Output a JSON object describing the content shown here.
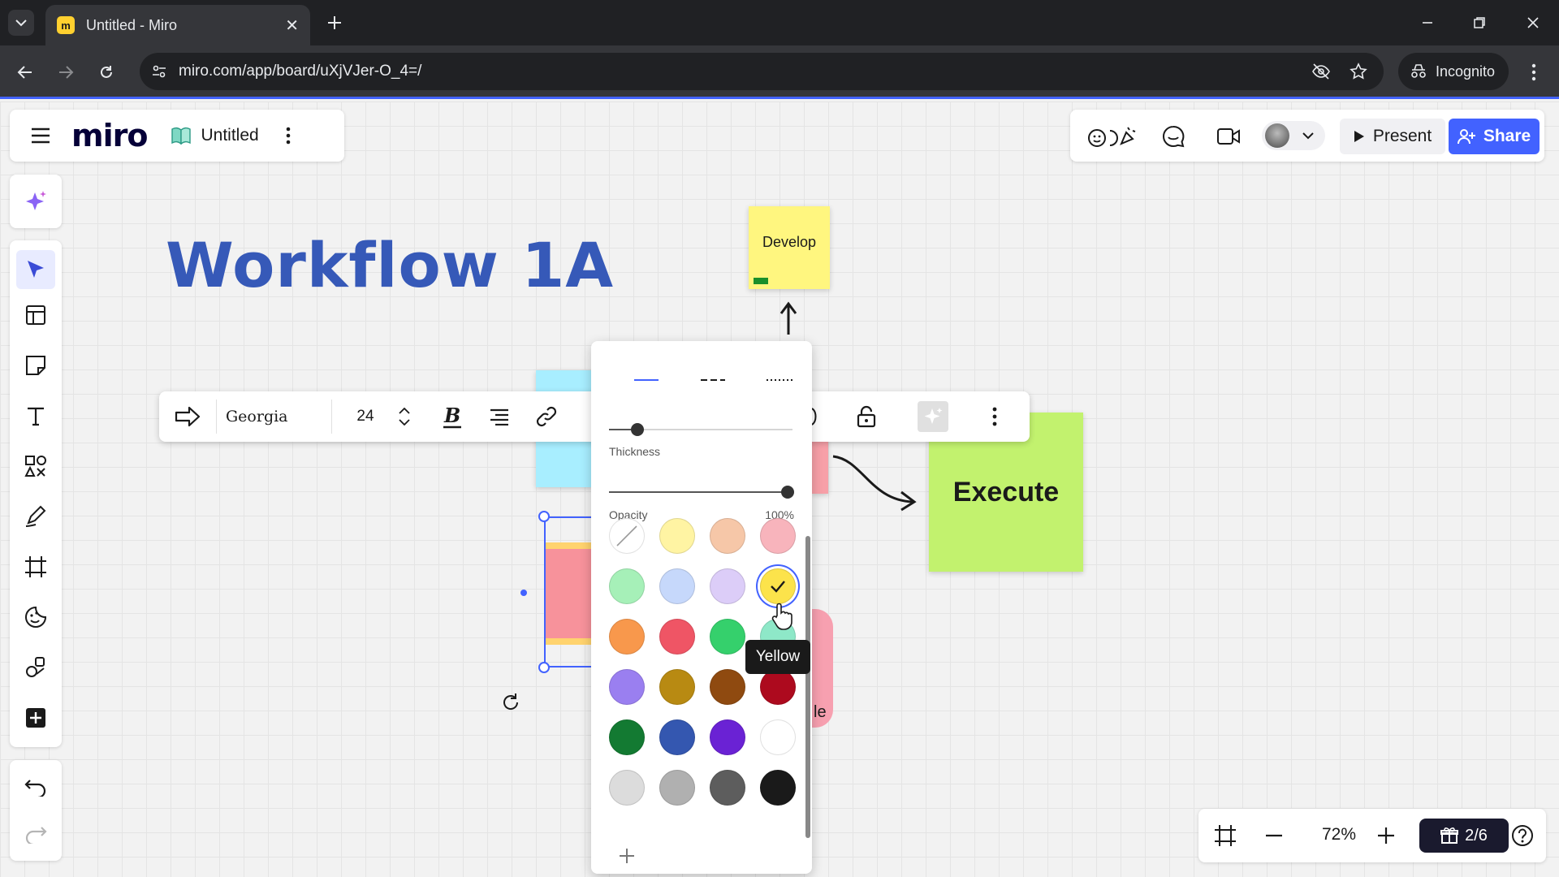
{
  "browser": {
    "tab_title": "Untitled - Miro",
    "favicon_letter": "m",
    "url": "miro.com/app/board/uXjVJer-O_4=/",
    "incognito_label": "Incognito"
  },
  "header": {
    "logo": "miro",
    "board_name": "Untitled"
  },
  "collab": {
    "present_label": "Present",
    "share_label": "Share"
  },
  "board": {
    "title": "Workflow 1A",
    "sticky_develop": "Develop",
    "sticky_execute": "Execute",
    "partial_text": "le"
  },
  "context_toolbar": {
    "font_family": "Georgia",
    "font_size": "24"
  },
  "line_popup": {
    "thickness_label": "Thickness",
    "thickness_value": 0.12,
    "opacity_label": "Opacity",
    "opacity_value": "100%",
    "colors": [
      {
        "name": "none",
        "hex": "#ffffff"
      },
      {
        "name": "light-yellow",
        "hex": "#fff4a3"
      },
      {
        "name": "light-orange",
        "hex": "#f6c7a8"
      },
      {
        "name": "light-pink",
        "hex": "#f8b4bc"
      },
      {
        "name": "light-green",
        "hex": "#a6f0b8"
      },
      {
        "name": "light-blue",
        "hex": "#c6d8fb"
      },
      {
        "name": "light-violet",
        "hex": "#dccdf8"
      },
      {
        "name": "yellow",
        "hex": "#fce34b"
      },
      {
        "name": "orange",
        "hex": "#f8984c"
      },
      {
        "name": "red",
        "hex": "#ef5565"
      },
      {
        "name": "green",
        "hex": "#35d06c"
      },
      {
        "name": "mint",
        "hex": "#8ee8c8"
      },
      {
        "name": "violet",
        "hex": "#9a7ff0"
      },
      {
        "name": "ochre",
        "hex": "#b88a12"
      },
      {
        "name": "brown",
        "hex": "#8f4a10"
      },
      {
        "name": "dark-red",
        "hex": "#ad0a1e"
      },
      {
        "name": "dark-green",
        "hex": "#137a32"
      },
      {
        "name": "dark-blue",
        "hex": "#3457b0"
      },
      {
        "name": "purple",
        "hex": "#6a22d4"
      },
      {
        "name": "white",
        "hex": "#ffffff"
      },
      {
        "name": "light-gray",
        "hex": "#dcdcdc"
      },
      {
        "name": "gray",
        "hex": "#b0b0b0"
      },
      {
        "name": "dark-gray",
        "hex": "#5d5d5d"
      },
      {
        "name": "black",
        "hex": "#1a1a1a"
      }
    ],
    "selected_color": "yellow",
    "tooltip": "Yellow"
  },
  "zoom": {
    "level": "72%",
    "pages": "2/6"
  },
  "theme": {
    "accent": "#4262ff",
    "title_blue": "#3659b8"
  }
}
